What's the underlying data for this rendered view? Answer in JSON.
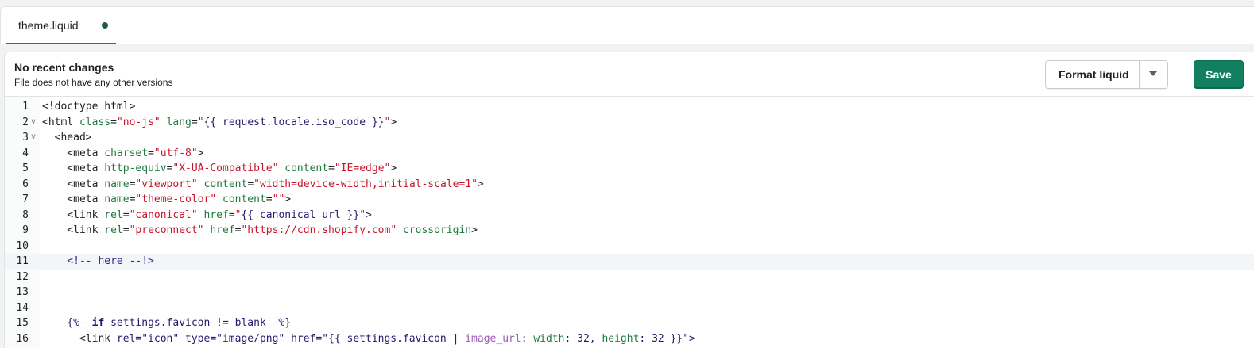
{
  "tab": {
    "label": "theme.liquid"
  },
  "header": {
    "title": "No recent changes",
    "subtitle": "File does not have any other versions",
    "format_label": "Format liquid",
    "save_label": "Save"
  },
  "colors": {
    "accent": "#128060",
    "unsaved_dot": "#1f5b48",
    "string": "#c7162b",
    "attribute": "#1e7a3c",
    "liquid": "#25196b",
    "filter": "#9b59b6"
  },
  "icons": {
    "format_caret": "caret-down-icon",
    "fold": "chevron-down-icon"
  },
  "editor": {
    "active_line": 11,
    "lines": [
      {
        "n": "1",
        "fold": "",
        "t": [
          [
            "tag",
            "<!doctype html>"
          ]
        ]
      },
      {
        "n": "2",
        "fold": "v",
        "t": [
          [
            "tag",
            "<html "
          ],
          [
            "attr",
            "class"
          ],
          [
            "tag",
            "="
          ],
          [
            "str",
            "\"no-js\""
          ],
          [
            "tag",
            " "
          ],
          [
            "attr",
            "lang"
          ],
          [
            "tag",
            "="
          ],
          [
            "str",
            "\""
          ],
          [
            "liq",
            "{{ request.locale.iso_code }}"
          ],
          [
            "str",
            "\""
          ],
          [
            "tag",
            ">"
          ]
        ]
      },
      {
        "n": "3",
        "fold": "v",
        "t": [
          [
            "tag",
            "  <head>"
          ]
        ]
      },
      {
        "n": "4",
        "fold": "",
        "t": [
          [
            "tag",
            "    <meta "
          ],
          [
            "attr",
            "charset"
          ],
          [
            "tag",
            "="
          ],
          [
            "str",
            "\"utf-8\""
          ],
          [
            "tag",
            ">"
          ]
        ]
      },
      {
        "n": "5",
        "fold": "",
        "t": [
          [
            "tag",
            "    <meta "
          ],
          [
            "attr",
            "http-equiv"
          ],
          [
            "tag",
            "="
          ],
          [
            "str",
            "\"X-UA-Compatible\""
          ],
          [
            "tag",
            " "
          ],
          [
            "attr",
            "content"
          ],
          [
            "tag",
            "="
          ],
          [
            "str",
            "\"IE=edge\""
          ],
          [
            "tag",
            ">"
          ]
        ]
      },
      {
        "n": "6",
        "fold": "",
        "t": [
          [
            "tag",
            "    <meta "
          ],
          [
            "attr",
            "name"
          ],
          [
            "tag",
            "="
          ],
          [
            "str",
            "\"viewport\""
          ],
          [
            "tag",
            " "
          ],
          [
            "attr",
            "content"
          ],
          [
            "tag",
            "="
          ],
          [
            "str",
            "\"width=device-width,initial-scale=1\""
          ],
          [
            "tag",
            ">"
          ]
        ]
      },
      {
        "n": "7",
        "fold": "",
        "t": [
          [
            "tag",
            "    <meta "
          ],
          [
            "attr",
            "name"
          ],
          [
            "tag",
            "="
          ],
          [
            "str",
            "\"theme-color\""
          ],
          [
            "tag",
            " "
          ],
          [
            "attr",
            "content"
          ],
          [
            "tag",
            "="
          ],
          [
            "str",
            "\"\""
          ],
          [
            "tag",
            ">"
          ]
        ]
      },
      {
        "n": "8",
        "fold": "",
        "t": [
          [
            "tag",
            "    <link "
          ],
          [
            "attr",
            "rel"
          ],
          [
            "tag",
            "="
          ],
          [
            "str",
            "\"canonical\""
          ],
          [
            "tag",
            " "
          ],
          [
            "attr",
            "href"
          ],
          [
            "tag",
            "="
          ],
          [
            "str",
            "\""
          ],
          [
            "liq",
            "{{ canonical_url }}"
          ],
          [
            "str",
            "\""
          ],
          [
            "tag",
            ">"
          ]
        ]
      },
      {
        "n": "9",
        "fold": "",
        "t": [
          [
            "tag",
            "    <link "
          ],
          [
            "attr",
            "rel"
          ],
          [
            "tag",
            "="
          ],
          [
            "str",
            "\"preconnect\""
          ],
          [
            "tag",
            " "
          ],
          [
            "attr",
            "href"
          ],
          [
            "tag",
            "="
          ],
          [
            "str",
            "\"https://cdn.shopify.com\""
          ],
          [
            "tag",
            " "
          ],
          [
            "attr",
            "crossorigin"
          ],
          [
            "tag",
            ">"
          ]
        ]
      },
      {
        "n": "10",
        "fold": "",
        "t": []
      },
      {
        "n": "11",
        "fold": "",
        "t": [
          [
            "cmt",
            "    <!-- here --!>"
          ]
        ]
      },
      {
        "n": "12",
        "fold": "",
        "t": []
      },
      {
        "n": "13",
        "fold": "",
        "t": []
      },
      {
        "n": "14",
        "fold": "",
        "t": []
      },
      {
        "n": "15",
        "fold": "",
        "t": [
          [
            "liq",
            "    {%- "
          ],
          [
            "kw",
            "if"
          ],
          [
            "liq",
            " settings.favicon != blank -%}"
          ]
        ]
      },
      {
        "n": "16",
        "fold": "",
        "t": [
          [
            "tag",
            "      <link "
          ],
          [
            "liq",
            "rel="
          ],
          [
            "liq",
            "\"icon\" type=\"image/png\" href=\"{{ settings.favicon | "
          ],
          [
            "filter",
            "image_url"
          ],
          [
            "liq",
            ": "
          ],
          [
            "attr",
            "width"
          ],
          [
            "liq",
            ": 32, "
          ],
          [
            "attr",
            "height"
          ],
          [
            "liq",
            ": 32 }}\">"
          ]
        ]
      }
    ]
  }
}
